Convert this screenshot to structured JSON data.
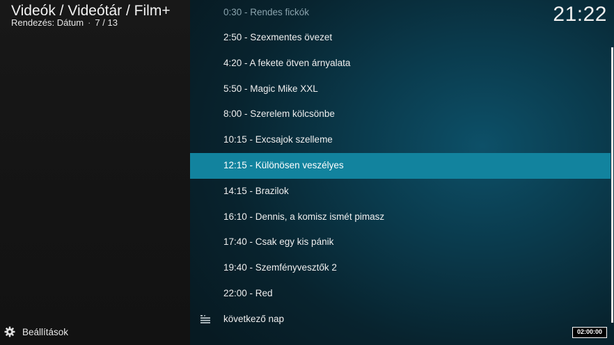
{
  "header": {
    "breadcrumb": "Videók / Videótár / Film+",
    "sort_label": "Rendezés: Dátum",
    "position": "7 / 13",
    "clock": "21:22"
  },
  "schedule": [
    {
      "label": "0:30 - Rendes fickók",
      "state": "dim"
    },
    {
      "label": "2:50 - Szexmentes övezet",
      "state": "normal"
    },
    {
      "label": "4:20 - A fekete ötven árnyalata",
      "state": "normal"
    },
    {
      "label": "5:50 - Magic Mike XXL",
      "state": "normal"
    },
    {
      "label": "8:00 - Szerelem kölcsönbe",
      "state": "normal"
    },
    {
      "label": "10:15 - Excsajok szelleme",
      "state": "normal"
    },
    {
      "label": "12:15 - Különösen veszélyes",
      "state": "selected"
    },
    {
      "label": "14:15 - Brazilok",
      "state": "normal"
    },
    {
      "label": "16:10 - Dennis, a komisz ismét pimasz",
      "state": "normal"
    },
    {
      "label": "17:40 - Csak egy kis pánik",
      "state": "normal"
    },
    {
      "label": "19:40 - Szemfényvesztők 2",
      "state": "normal"
    },
    {
      "label": "22:00 - Red",
      "state": "normal"
    }
  ],
  "next_day": {
    "label": "következő nap",
    "icon": "playlist-icon"
  },
  "footer": {
    "settings_label": "Beállítások",
    "settings_icon": "gear-icon",
    "timer": "02:00:00"
  },
  "colors": {
    "selected": "#12839e",
    "background": "#0a3a4c",
    "sidebar": "#161616"
  }
}
